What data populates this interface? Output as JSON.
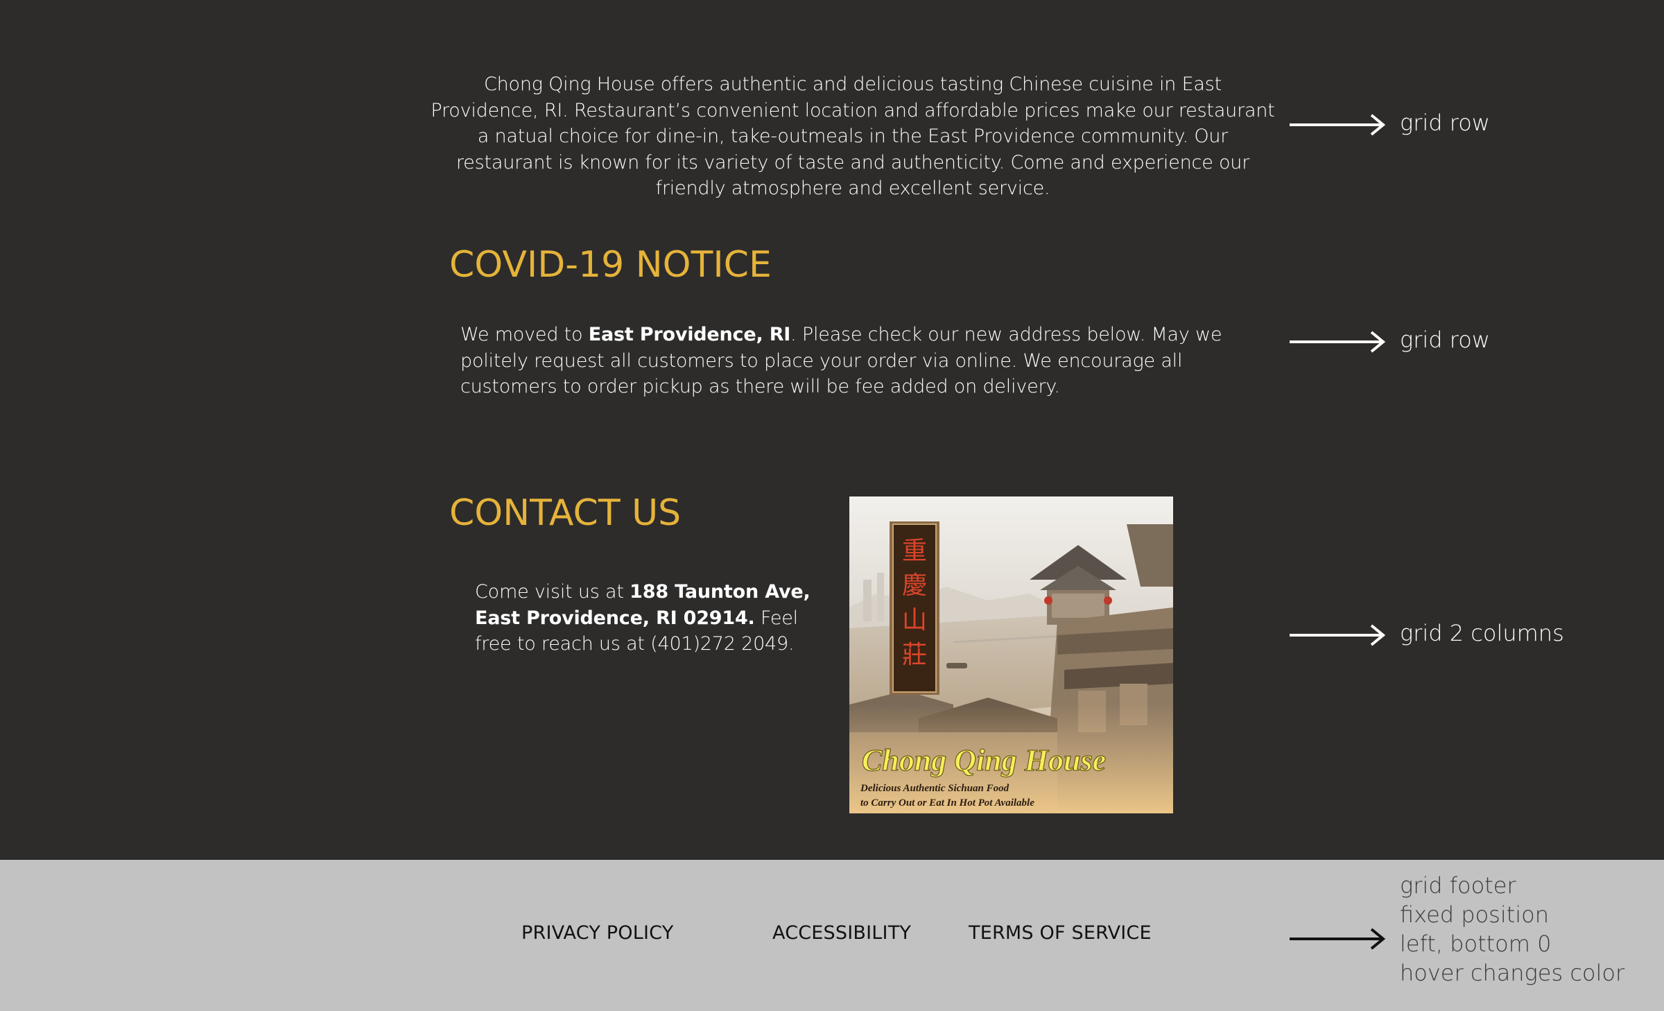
{
  "intro": {
    "text": "Chong Qing House offers authentic and delicious tasting Chinese cuisine in East Providence, RI. Restaurant’s convenient location and affordable prices make our restaurant a natual choice for dine-in, take-outmeals in the East Providence community. Our restaurant is known for its variety of taste and authenticity. Come and experience our friendly atmosphere and excellent service."
  },
  "covid": {
    "heading": "COVID-19 NOTICE",
    "text_before": "We moved to ",
    "text_bold": "East Providence, RI",
    "text_after": ". Please check our new address below. May we politely request all customers to place your order via online. We encourage all customers to order pickup as there will be fee added on delivery."
  },
  "contact": {
    "heading": "CONTACT US",
    "text_before": "Come visit us at ",
    "text_bold": "188 Taunton Ave, East Providence, RI 02914.",
    "text_after": " Feel free to reach us at (401)272 2049.",
    "image": {
      "title": "Chong Qing House",
      "chinese": [
        "重",
        "慶",
        "山",
        "莊"
      ],
      "tagline_1": "Delicious Authentic Sichuan Food",
      "tagline_2": "to Carry Out or Eat In Hot Pot Available"
    }
  },
  "footer": {
    "links": [
      "PRIVACY POLICY",
      "ACCESSIBILITY",
      "TERMS OF SERVICE"
    ],
    "background": "#c2c2c2"
  },
  "annotations": {
    "row1": "grid row",
    "row2": "grid row",
    "row3": "grid 2 columns",
    "footer_lines": [
      "grid footer",
      "fixed position",
      "left, bottom 0",
      "hover changes color"
    ]
  },
  "colors": {
    "background": "#2d2c2b",
    "heading": "#e6b33a",
    "text": "#ffffff"
  }
}
